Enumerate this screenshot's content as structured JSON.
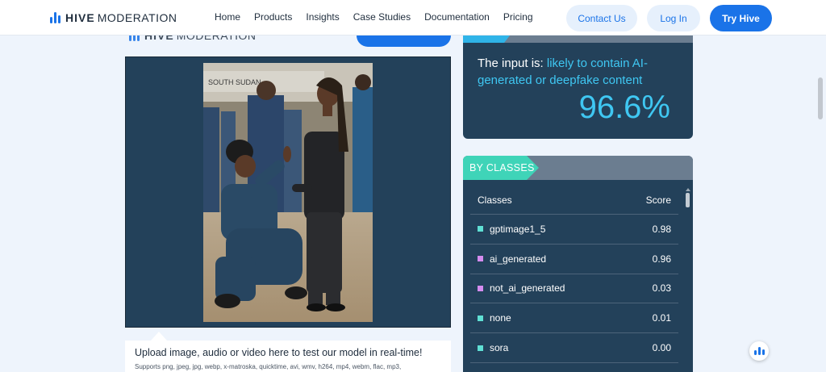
{
  "brand": {
    "strong": "HIVE",
    "light": "MODERATION"
  },
  "nav": {
    "links": [
      "Home",
      "Products",
      "Insights",
      "Case Studies",
      "Documentation",
      "Pricing"
    ],
    "contact_label": "Contact Us",
    "login_label": "Log In",
    "try_label": "Try Hive"
  },
  "colors": {
    "accent": "#1a73e8",
    "panel": "#23415a",
    "highlight": "#3fc7f2",
    "tag": "#3fd4b8"
  },
  "upload": {
    "title": "Upload image, audio or video here to test our model in real-time!",
    "supports": "Supports png, jpeg, jpg, webp, x-matroska, quicktime, avi, wmv, h264, mp4, webm, flac, mp3,"
  },
  "result": {
    "prefix": "The input is: ",
    "verdict": "likely to contain AI-generated or deepfake content",
    "percent": "96.6%"
  },
  "classes": {
    "tag": "BY CLASSES",
    "header_class": "Classes",
    "header_score": "Score",
    "rows": [
      {
        "name": "gptimage1_5",
        "score": "0.98",
        "color": "#5fe0d4"
      },
      {
        "name": "ai_generated",
        "score": "0.96",
        "color": "#d58cf0"
      },
      {
        "name": "not_ai_generated",
        "score": "0.03",
        "color": "#d58cf0"
      },
      {
        "name": "none",
        "score": "0.01",
        "color": "#5fe0d4"
      },
      {
        "name": "sora",
        "score": "0.00",
        "color": "#5fe0d4"
      }
    ]
  },
  "photo": {
    "sign_text": "SOUTH SUDAN"
  }
}
